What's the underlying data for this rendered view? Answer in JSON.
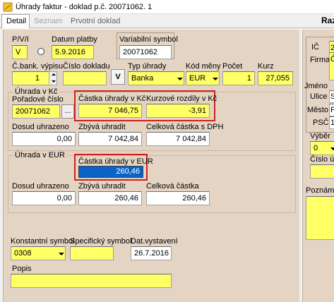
{
  "window": {
    "title": "Úhrady faktur - doklad p.č. 20071062.  1",
    "right_header": "Raz"
  },
  "tabs": [
    {
      "label": "Detail",
      "active": true
    },
    {
      "label": "Seznam",
      "active": false,
      "disabled": true
    },
    {
      "label": "Prvotní doklad",
      "active": false
    }
  ],
  "form": {
    "pvi_label": "P/V/I",
    "pvi_value": "V",
    "datum_platby_label": "Datum platby",
    "datum_platby_value": "5.9.2016",
    "vs_label": "Variabilní symbol",
    "vs_value": "20071062",
    "cislo_vypisu_label": "Č.bank. výpisu",
    "cislo_vypisu_value": "1",
    "cislo_dokladu_label": "Číslo dokladu",
    "cislo_dokladu_value": "",
    "v_button": "V",
    "typ_uhrady_label": "Typ úhrady",
    "typ_uhrady_value": "Banka",
    "kod_meny_label": "Kód měny",
    "kod_meny_value": "EUR",
    "pocet_label": "Počet",
    "pocet_value": "1",
    "kurz_label": "Kurz",
    "kurz_value": "27,055"
  },
  "group_kc": {
    "title": "Úhrada v Kč",
    "poradove_label": "Pořadové číslo",
    "poradove_value": "20071062",
    "browse_button": "...",
    "castka_label": "Částka úhrady v Kč",
    "castka_value": "7 046,75",
    "kurzove_label": "Kurzové rozdíly v Kč",
    "kurzove_value": "-3,91",
    "dosud_label": "Dosud uhrazeno",
    "dosud_value": "0,00",
    "zbyva_label": "Zbývá uhradit",
    "zbyva_value": "7 042,84",
    "celkova_label": "Celková částka s DPH",
    "celkova_value": "7 042,84"
  },
  "group_eur": {
    "title": "Úhrada v EUR",
    "castka_label": "Částka úhrady v EUR",
    "castka_value": "260,46",
    "dosud_label": "Dosud uhrazeno",
    "dosud_value": "0,00",
    "zbyva_label": "Zbývá uhradit",
    "zbyva_value": "260,46",
    "celkova_label": "Celková částka",
    "celkova_value": "260,46"
  },
  "bottom": {
    "konst_label": "Konstantní symbol",
    "konst_value": "0308",
    "spec_label": "Specifický symbol",
    "spec_value": "",
    "datvyst_label": "Dat.vystavení",
    "datvyst_value": "26.7.2016",
    "popis_label": "Popis",
    "popis_value": ""
  },
  "right_panel": {
    "ic_label": "IČ",
    "ic_value": "2",
    "firma_label": "Firma",
    "firma_value": "Č",
    "jmeno_label": "Jméno",
    "ulice_label": "Ulice",
    "ulice_value": "S",
    "mesto_label": "Město",
    "mesto_value": "P",
    "psc_label": "PSČ",
    "psc_value": "1",
    "vyber_label": "Výběr",
    "vyber_value": "0",
    "cislo_uctu_label": "Číslo účt",
    "poznamka_label": "Poznámk"
  },
  "colors": {
    "panel": "#e3d4c4",
    "field_yellow": "#ffff66",
    "highlight_red": "#d0201c",
    "selection": "#0a64c8"
  }
}
